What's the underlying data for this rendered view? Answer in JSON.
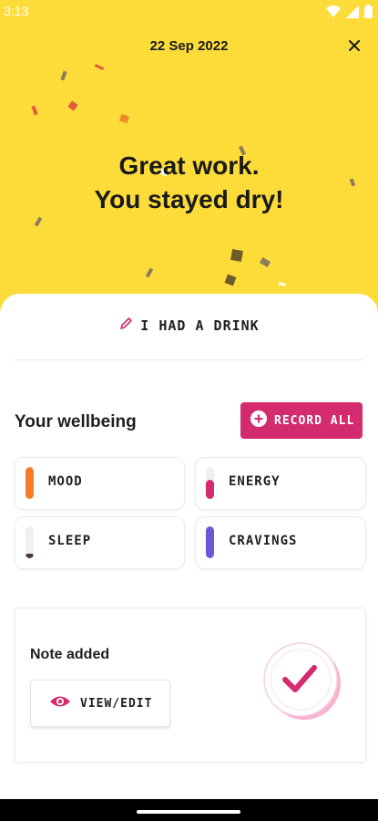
{
  "status_bar": {
    "time": "3:13"
  },
  "header": {
    "date": "22 Sep 2022",
    "headline_line1": "Great work.",
    "headline_line2": "You stayed dry!"
  },
  "drink_action": {
    "label": "I HAD A DRINK"
  },
  "wellbeing": {
    "title": "Your wellbeing",
    "record_all_label": "RECORD ALL",
    "items": [
      {
        "label": "MOOD",
        "color": "#f77c2a",
        "level": 1.0
      },
      {
        "label": "ENERGY",
        "color": "#d42a6e",
        "level": 0.6
      },
      {
        "label": "SLEEP",
        "color": "#4a3b36",
        "level": 0.15
      },
      {
        "label": "CRAVINGS",
        "color": "#6b58d6",
        "level": 1.0
      }
    ]
  },
  "note": {
    "title": "Note added",
    "view_edit_label": "VIEW/EDIT"
  },
  "colors": {
    "hero_yellow": "#fddc3a",
    "accent_pink": "#d42a6e"
  },
  "icons": {
    "close": "close-icon",
    "pencil": "pencil-icon",
    "plus": "plus-circle-icon",
    "eye": "eye-icon",
    "check": "check-icon",
    "wifi": "wifi-icon",
    "battery": "battery-icon"
  }
}
